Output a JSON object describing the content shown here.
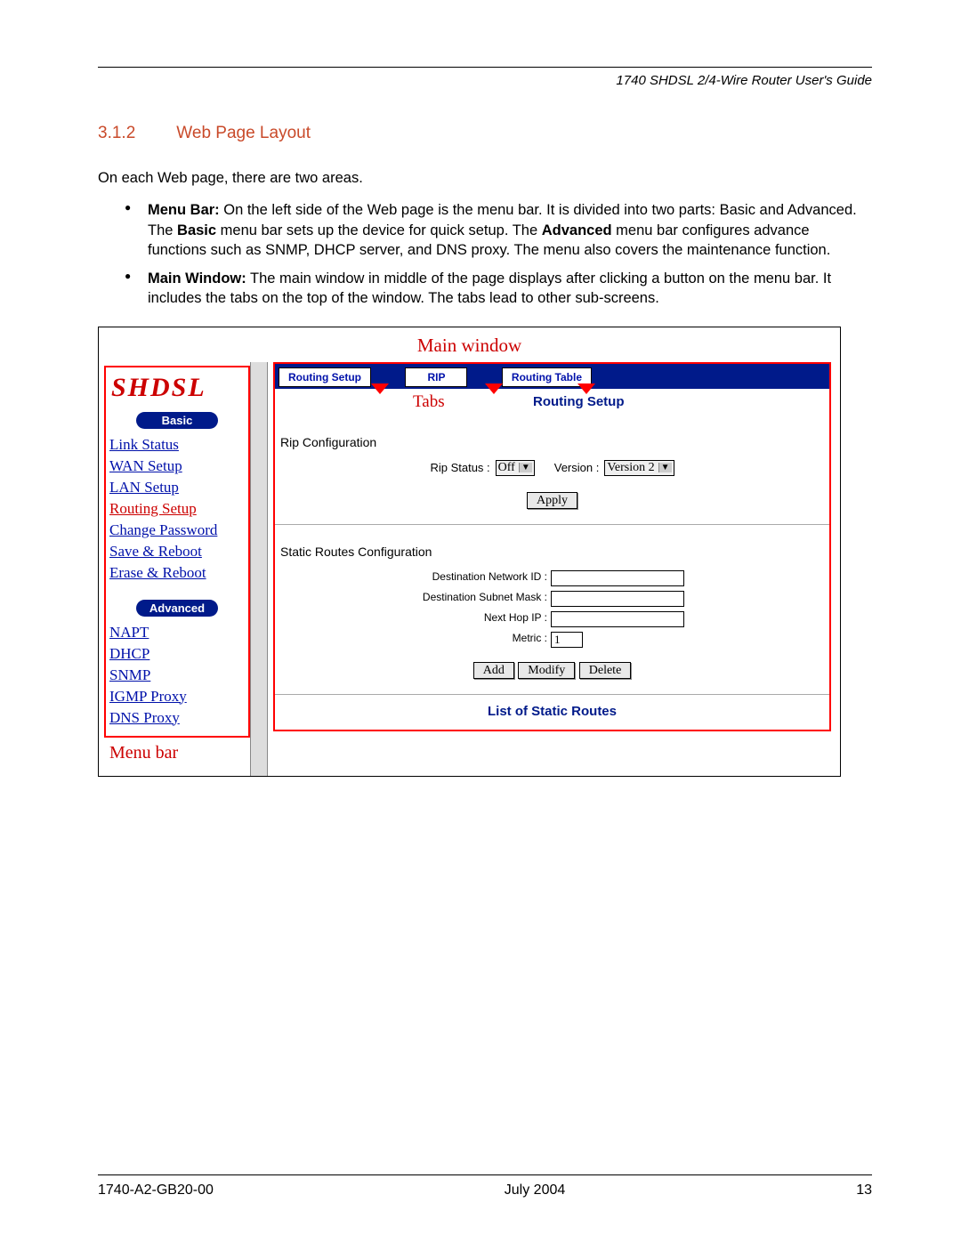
{
  "header": {
    "guide_title": "1740 SHDSL 2/4-Wire Router User's Guide"
  },
  "section": {
    "number": "3.1.2",
    "title": "Web Page Layout"
  },
  "intro": "On each Web page, there are two areas.",
  "bullets": {
    "b1_label": "Menu Bar:",
    "b1_text_a": "  On the left side of the Web page is the menu bar. It is divided into two parts: Basic and Advanced. The ",
    "b1_bold1": "Basic",
    "b1_text_b": " menu bar sets up the device for quick setup. The ",
    "b1_bold2": "Advanced",
    "b1_text_c": " menu bar configures advance functions such as SNMP, DHCP server, and DNS proxy. The menu also covers the maintenance function.",
    "b2_label": "Main Window:",
    "b2_text": " The main window in middle of the page displays after clicking a button on the menu bar. It includes the tabs on the top of the window. The tabs lead to other sub-screens."
  },
  "figure": {
    "main_window_label": "Main window",
    "logo": "SHDSL",
    "pill_basic": "Basic",
    "pill_advanced": "Advanced",
    "menu_basic": [
      "Link Status",
      "WAN Setup",
      "LAN Setup",
      "Routing Setup",
      "Change Password",
      "Save & Reboot",
      "Erase & Reboot"
    ],
    "menu_advanced": [
      "NAPT",
      "DHCP",
      "SNMP",
      "IGMP Proxy",
      "DNS Proxy"
    ],
    "menu_bar_label": "Menu bar",
    "tabs": {
      "t1": "Routing Setup",
      "t2": "RIP",
      "t3": "Routing Table"
    },
    "tabs_label": "Tabs",
    "panel_title": "Routing Setup",
    "rip_section": "Rip Configuration",
    "rip_status_label": "Rip Status :",
    "rip_status_value": "Off",
    "version_label": "Version :",
    "version_value": "Version 2",
    "apply_btn": "Apply",
    "static_section": "Static Routes Configuration",
    "fields": {
      "dest_net": "Destination Network ID :",
      "dest_mask": "Destination Subnet Mask :",
      "next_hop": "Next Hop IP :",
      "metric": "Metric :",
      "metric_value": "1"
    },
    "btns": {
      "add": "Add",
      "modify": "Modify",
      "delete": "Delete"
    },
    "list_title": "List of Static Routes"
  },
  "footer": {
    "doc_id": "1740-A2-GB20-00",
    "date": "July 2004",
    "page": "13"
  }
}
